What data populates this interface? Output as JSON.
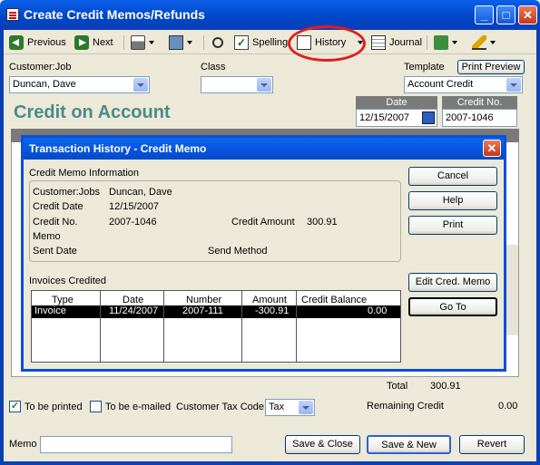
{
  "window": {
    "title": "Create Credit Memos/Refunds",
    "min": "_",
    "max": "□",
    "close": "✕"
  },
  "toolbar": {
    "previous": "Previous",
    "next": "Next",
    "spelling": "Spelling",
    "history": "History",
    "journal": "Journal"
  },
  "form": {
    "customer_job_label": "Customer:Job",
    "customer_job_value": "Duncan, Dave",
    "class_label": "Class",
    "class_value": "",
    "template_label": "Template",
    "template_value": "Account Credit",
    "print_preview": "Print Preview",
    "heading": "Credit on Account",
    "date_label": "Date",
    "date_value": "12/15/2007",
    "credit_no_label": "Credit No.",
    "credit_no_value": "2007-1046"
  },
  "dialog": {
    "title": "Transaction History - Credit Memo",
    "close": "✕",
    "info_header": "Credit Memo Information",
    "customer_jobs_label": "Customer:Jobs",
    "customer_jobs_value": "Duncan, Dave",
    "credit_date_label": "Credit Date",
    "credit_date_value": "12/15/2007",
    "credit_no_label": "Credit No.",
    "credit_no_value": "2007-1046",
    "credit_amount_label": "Credit Amount",
    "credit_amount_value": "300.91",
    "memo_label": "Memo",
    "sent_date_label": "Sent Date",
    "send_method_label": "Send Method",
    "invoices_header": "Invoices Credited",
    "buttons": {
      "cancel": "Cancel",
      "help": "Help",
      "print": "Print",
      "edit": "Edit Cred. Memo",
      "goto": "Go To"
    },
    "columns": [
      "Type",
      "Date",
      "Number",
      "Amount",
      "Credit Balance"
    ],
    "rows": [
      {
        "type": "Invoice",
        "date": "11/24/2007",
        "number": "2007-111",
        "amount": "-300.91",
        "balance": "0.00"
      }
    ]
  },
  "totals": {
    "total_label": "Total",
    "total_value": "300.91",
    "remaining_label": "Remaining Credit",
    "remaining_value": "0.00"
  },
  "footer": {
    "to_be_printed": "To be printed",
    "to_be_printed_checked": true,
    "to_be_emailed": "To be e-mailed",
    "to_be_emailed_checked": false,
    "tax_code_label": "Customer Tax Code",
    "tax_code_value": "Tax",
    "memo_label": "Memo",
    "save_close": "Save & Close",
    "save_new": "Save & New",
    "revert": "Revert"
  },
  "colors": {
    "title_bar": "#0045c8",
    "heading": "#4a8a8a",
    "highlight_ring": "#e01c1c",
    "selected_row": "#000000"
  }
}
